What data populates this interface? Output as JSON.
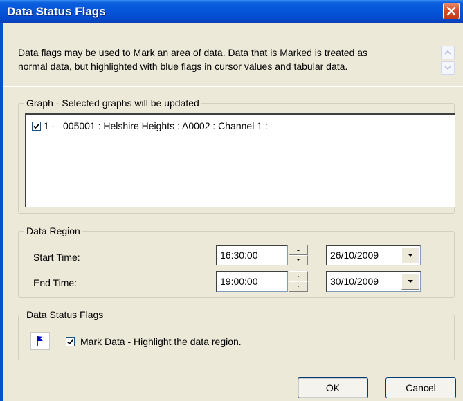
{
  "window": {
    "title": "Data Status Flags"
  },
  "description": {
    "line1": "Data flags may be used to Mark an area of data. Data that is Marked is treated as",
    "line2": "normal data, but highlighted with blue flags in cursor values and tabular data."
  },
  "graph_group": {
    "label": "Graph - Selected graphs will be updated",
    "items": [
      {
        "label": "1 - _005001 : Helshire Heights : A0002 : Channel 1 :",
        "checked": true
      }
    ]
  },
  "data_region": {
    "label": "Data Region",
    "start": {
      "label": "Start Time:",
      "time": "16:30:00",
      "date": "26/10/2009"
    },
    "end": {
      "label": "End Time:",
      "time": "19:00:00",
      "date": "30/10/2009"
    }
  },
  "status_flags": {
    "label": "Data Status Flags",
    "flag_icon": "blue-flag",
    "mark": {
      "label": "Mark Data - Highlight the data region.",
      "checked": true
    }
  },
  "buttons": {
    "ok": "OK",
    "cancel": "Cancel"
  },
  "colors": {
    "titlebar": "#0554d8",
    "flag": "#0000cc",
    "window_bg": "#ece9d8"
  }
}
